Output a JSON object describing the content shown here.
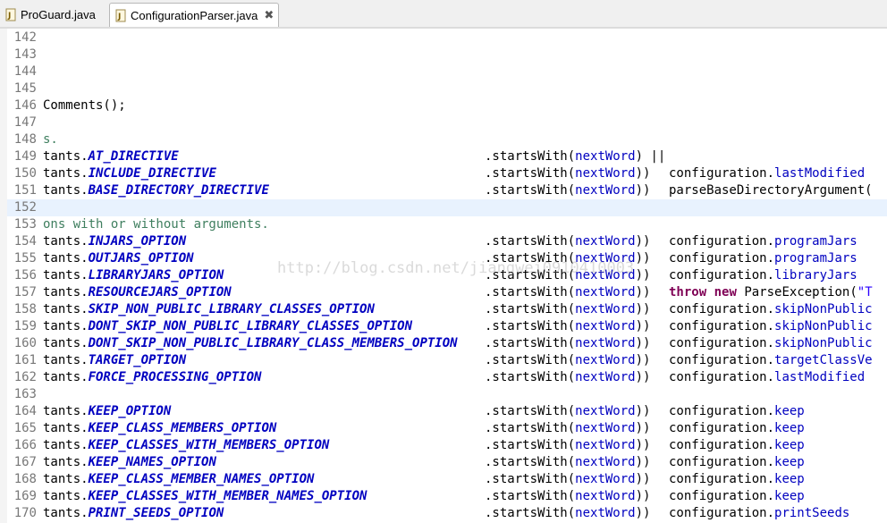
{
  "tabs": [
    {
      "label": "ProGuard.java",
      "active": false
    },
    {
      "label": "ConfigurationParser.java",
      "active": true,
      "close_symbol": "✖"
    }
  ],
  "editor": {
    "highlighted_line": "152",
    "watermark": "http://blog.csdn.net/jiangwei0910410003",
    "lines": [
      {
        "n": "142",
        "code": "",
        "cont": "",
        "tail": ""
      },
      {
        "n": "143",
        "code": "",
        "cont": "",
        "tail": ""
      },
      {
        "n": "144",
        "code": "",
        "cont": "",
        "tail": ""
      },
      {
        "n": "145",
        "code": "",
        "cont": "",
        "tail": ""
      },
      {
        "n": "146",
        "code": "Comments();",
        "cont": "",
        "tail": ""
      },
      {
        "n": "147",
        "code": "",
        "cont": "",
        "tail": ""
      },
      {
        "n": "148",
        "comment": "s.",
        "cont": "",
        "tail": ""
      },
      {
        "n": "149",
        "prefix": "tants.",
        "const": "AT_DIRECTIVE",
        "cont": ".startsWith(",
        "arg": "nextWord",
        "close": ") ||",
        "tail": ""
      },
      {
        "n": "150",
        "prefix": "tants.",
        "const": "INCLUDE_DIRECTIVE",
        "cont": ".startsWith(",
        "arg": "nextWord",
        "close": "))",
        "tail_obj": "configuration.",
        "tail_field": "lastModified"
      },
      {
        "n": "151",
        "prefix": "tants.",
        "const": "BASE_DIRECTORY_DIRECTIVE",
        "cont": ".startsWith(",
        "arg": "nextWord",
        "close": "))",
        "tail_plain": "parseBaseDirectoryArgument("
      },
      {
        "n": "152",
        "code": "",
        "cont": "",
        "tail": ""
      },
      {
        "n": "153",
        "comment": "ons with or without arguments.",
        "cont": "",
        "tail": ""
      },
      {
        "n": "154",
        "prefix": "tants.",
        "const": "INJARS_OPTION",
        "cont": ".startsWith(",
        "arg": "nextWord",
        "close": "))",
        "tail_obj": "configuration.",
        "tail_field": "programJars"
      },
      {
        "n": "155",
        "prefix": "tants.",
        "const": "OUTJARS_OPTION",
        "cont": ".startsWith(",
        "arg": "nextWord",
        "close": "))",
        "tail_obj": "configuration.",
        "tail_field": "programJars"
      },
      {
        "n": "156",
        "prefix": "tants.",
        "const": "LIBRARYJARS_OPTION",
        "cont": ".startsWith(",
        "arg": "nextWord",
        "close": "))",
        "tail_obj": "configuration.",
        "tail_field": "libraryJars"
      },
      {
        "n": "157",
        "prefix": "tants.",
        "const": "RESOURCEJARS_OPTION",
        "cont": ".startsWith(",
        "arg": "nextWord",
        "close": "))",
        "tail_kw1": "throw",
        "tail_kw2": "new",
        "tail_after": "ParseException(",
        "tail_str": "\"T"
      },
      {
        "n": "158",
        "prefix": "tants.",
        "const": "SKIP_NON_PUBLIC_LIBRARY_CLASSES_OPTION",
        "cont": ".startsWith(",
        "arg": "nextWord",
        "close": "))",
        "tail_obj": "configuration.",
        "tail_field": "skipNonPublic"
      },
      {
        "n": "159",
        "prefix": "tants.",
        "const": "DONT_SKIP_NON_PUBLIC_LIBRARY_CLASSES_OPTION",
        "cont": ".startsWith(",
        "arg": "nextWord",
        "close": "))",
        "tail_obj": "configuration.",
        "tail_field": "skipNonPublic"
      },
      {
        "n": "160",
        "prefix": "tants.",
        "const": "DONT_SKIP_NON_PUBLIC_LIBRARY_CLASS_MEMBERS_OPTION",
        "cont": ".startsWith(",
        "arg": "nextWord",
        "close": "))",
        "tail_obj": "configuration.",
        "tail_field": "skipNonPublic"
      },
      {
        "n": "161",
        "prefix": "tants.",
        "const": "TARGET_OPTION",
        "cont": ".startsWith(",
        "arg": "nextWord",
        "close": "))",
        "tail_obj": "configuration.",
        "tail_field": "targetClassVe"
      },
      {
        "n": "162",
        "prefix": "tants.",
        "const": "FORCE_PROCESSING_OPTION",
        "cont": ".startsWith(",
        "arg": "nextWord",
        "close": "))",
        "tail_obj": "configuration.",
        "tail_field": "lastModified"
      },
      {
        "n": "163",
        "code": "",
        "cont": "",
        "tail": ""
      },
      {
        "n": "164",
        "prefix": "tants.",
        "const": "KEEP_OPTION",
        "cont": ".startsWith(",
        "arg": "nextWord",
        "close": "))",
        "tail_obj": "configuration.",
        "tail_field": "keep"
      },
      {
        "n": "165",
        "prefix": "tants.",
        "const": "KEEP_CLASS_MEMBERS_OPTION",
        "cont": ".startsWith(",
        "arg": "nextWord",
        "close": "))",
        "tail_obj": "configuration.",
        "tail_field": "keep"
      },
      {
        "n": "166",
        "prefix": "tants.",
        "const": "KEEP_CLASSES_WITH_MEMBERS_OPTION",
        "cont": ".startsWith(",
        "arg": "nextWord",
        "close": "))",
        "tail_obj": "configuration.",
        "tail_field": "keep"
      },
      {
        "n": "167",
        "prefix": "tants.",
        "const": "KEEP_NAMES_OPTION",
        "cont": ".startsWith(",
        "arg": "nextWord",
        "close": "))",
        "tail_obj": "configuration.",
        "tail_field": "keep"
      },
      {
        "n": "168",
        "prefix": "tants.",
        "const": "KEEP_CLASS_MEMBER_NAMES_OPTION",
        "cont": ".startsWith(",
        "arg": "nextWord",
        "close": "))",
        "tail_obj": "configuration.",
        "tail_field": "keep"
      },
      {
        "n": "169",
        "prefix": "tants.",
        "const": "KEEP_CLASSES_WITH_MEMBER_NAMES_OPTION",
        "cont": ".startsWith(",
        "arg": "nextWord",
        "close": "))",
        "tail_obj": "configuration.",
        "tail_field": "keep"
      },
      {
        "n": "170",
        "prefix": "tants.",
        "const": "PRINT_SEEDS_OPTION",
        "cont": ".startsWith(",
        "arg": "nextWord",
        "close": "))",
        "tail_obj": "configuration.",
        "tail_field": "printSeeds"
      }
    ]
  }
}
